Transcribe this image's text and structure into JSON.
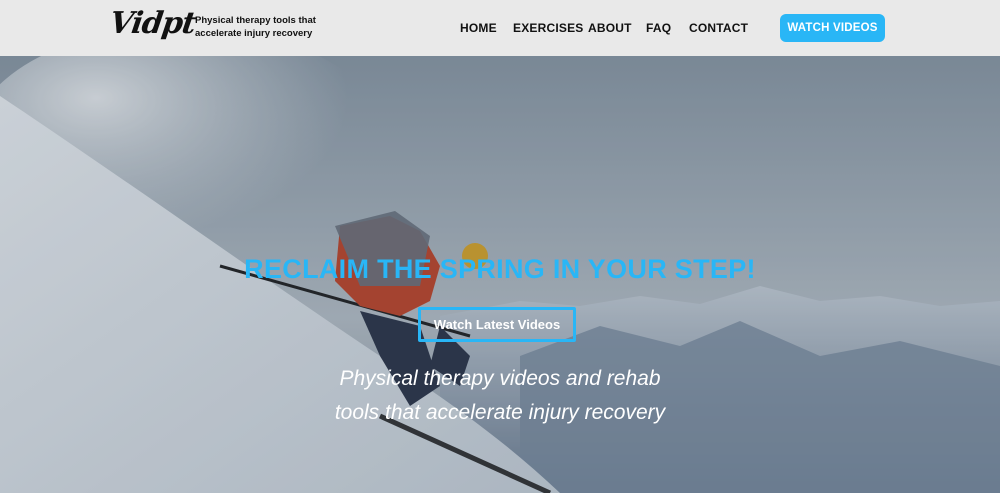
{
  "header": {
    "logo_text": "Vidpt",
    "tagline": "Physical therapy tools that accelerate injury recovery",
    "nav": [
      "HOME",
      "EXERCISES",
      "ABOUT",
      "FAQ",
      "CONTACT"
    ],
    "cta_label": "WATCH VIDEOS",
    "accent_color": "#29b6f6"
  },
  "hero": {
    "headline": "RECLAIM THE SPRING IN YOUR STEP!",
    "button_label": "Watch Latest Videos",
    "subtitle_line1": "Physical therapy videos and rehab",
    "subtitle_line2": "tools that accelerate injury recovery",
    "background_image": "skier descending snowy mountain slope"
  }
}
